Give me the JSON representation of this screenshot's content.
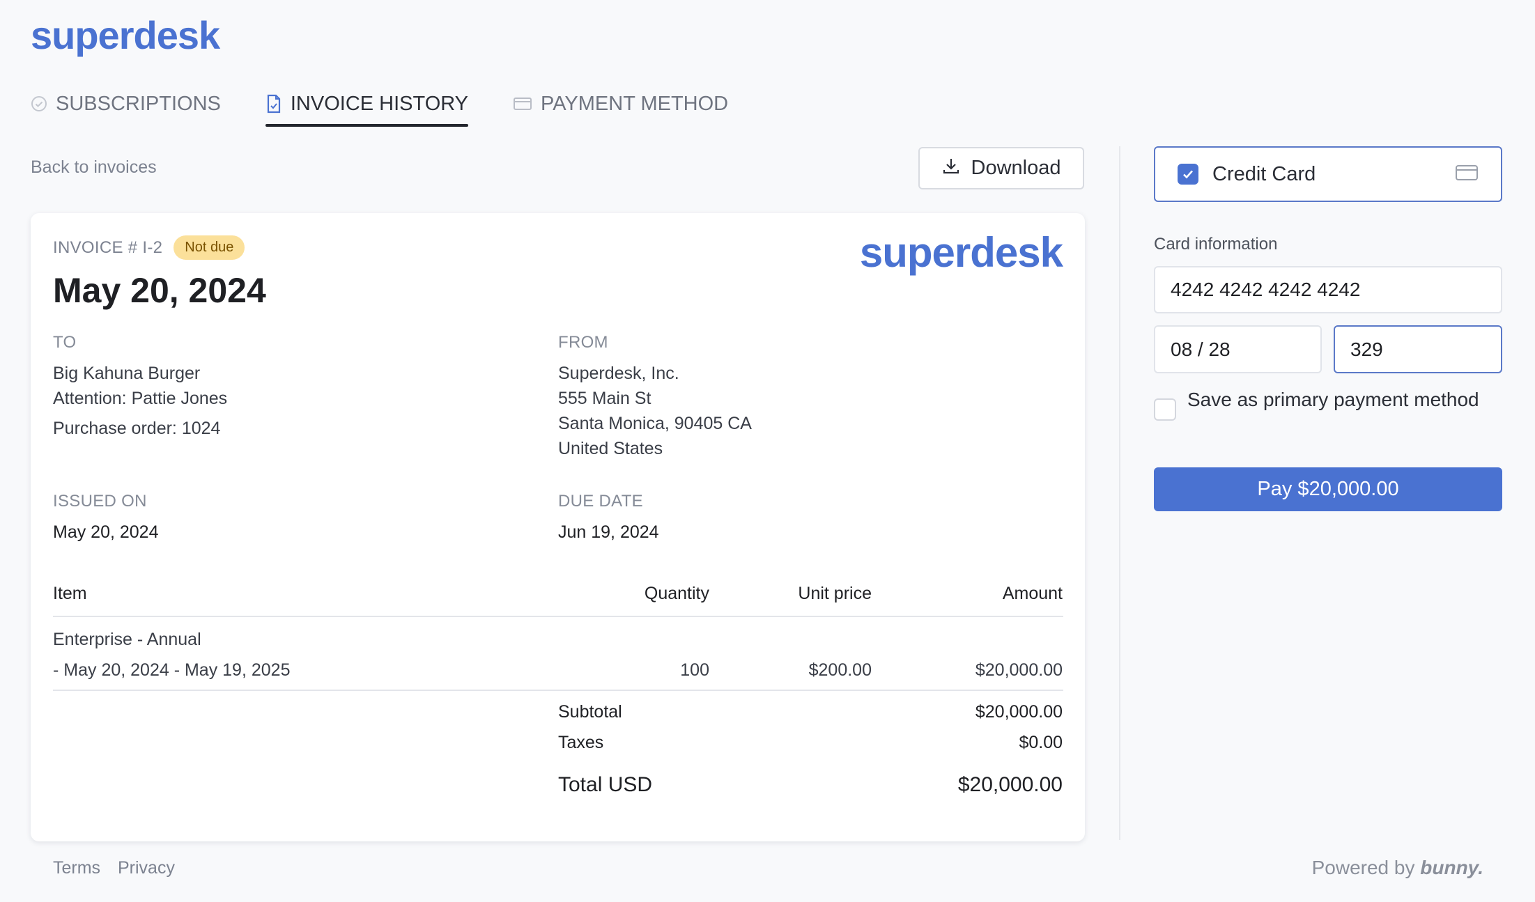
{
  "app": {
    "brand": "superdesk"
  },
  "tabs": [
    {
      "label": "SUBSCRIPTIONS",
      "icon": "check-circle-icon"
    },
    {
      "label": "INVOICE HISTORY",
      "icon": "invoice-icon",
      "active": true
    },
    {
      "label": "PAYMENT METHOD",
      "icon": "credit-card-icon"
    }
  ],
  "toolbar": {
    "back_label": "Back to invoices",
    "download_label": "Download"
  },
  "invoice": {
    "number": "INVOICE # I-2",
    "status": "Not due",
    "brand": "superdesk",
    "date": "May 20, 2024",
    "to": {
      "label": "TO",
      "name": "Big Kahuna Burger",
      "attention": "Attention: Pattie Jones",
      "po": "Purchase order: 1024"
    },
    "from": {
      "label": "FROM",
      "lines": [
        "Superdesk, Inc.",
        "555 Main St",
        "Santa Monica, 90405 CA",
        "United States"
      ]
    },
    "issued": {
      "label": "ISSUED ON",
      "value": "May 20, 2024"
    },
    "due": {
      "label": "DUE DATE",
      "value": "Jun 19, 2024"
    },
    "columns": [
      "Item",
      "Quantity",
      "Unit price",
      "Amount"
    ],
    "items": [
      {
        "name": "Enterprise - Annual",
        "period": "- May 20, 2024 - May 19, 2025",
        "quantity": "100",
        "unit_price": "$200.00",
        "amount": "$20,000.00"
      }
    ],
    "subtotal": {
      "label": "Subtotal",
      "value": "$20,000.00"
    },
    "taxes": {
      "label": "Taxes",
      "value": "$0.00"
    },
    "total": {
      "label": "Total USD",
      "value": "$20,000.00"
    }
  },
  "payment": {
    "method_label": "Credit Card",
    "card_info_label": "Card information",
    "card_number": "4242 4242 4242 4242",
    "expiry": "08 / 28",
    "cvc": "329",
    "save_label": "Save as primary payment method",
    "pay_label": "Pay $20,000.00"
  },
  "footer": {
    "terms": "Terms",
    "privacy": "Privacy",
    "powered_prefix": "Powered by",
    "powered_brand": "bunny."
  },
  "colors": {
    "accent": "#4a72d1",
    "badge_bg": "#fbe09a",
    "badge_text": "#7a5200"
  }
}
